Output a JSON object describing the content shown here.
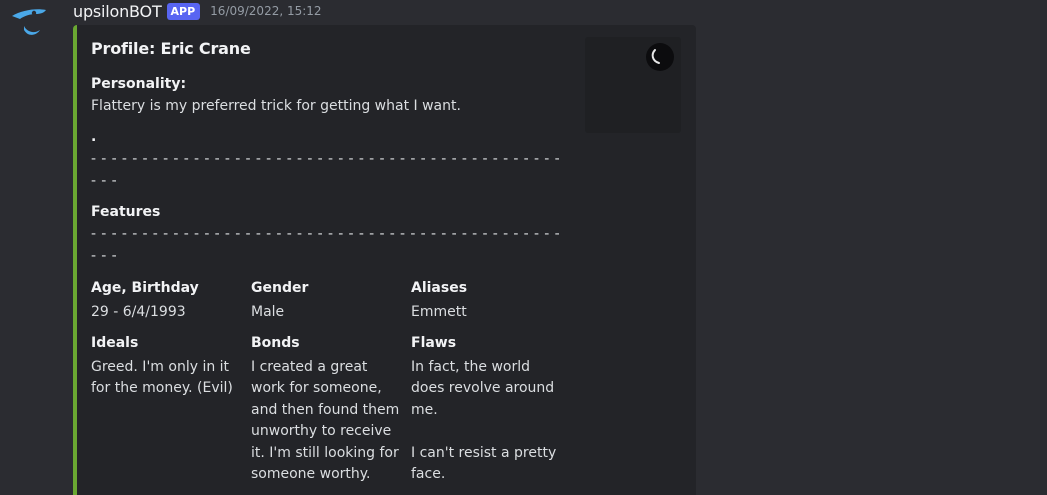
{
  "message": {
    "username": "upsilonBOT",
    "badge": "APP",
    "timestamp": "16/09/2022, 15:12"
  },
  "colors": {
    "embed_accent": "#6aa832",
    "badge_bg": "#5865f2",
    "avatar": "#4aa8e8"
  },
  "embed": {
    "title": "Profile: Eric Crane",
    "personality_label": "Personality:",
    "personality_text": "Flattery is my preferred trick for getting what I want.",
    "dot": ".",
    "separator_line1": "- - - - - - - - - - - - - - - - - - - - - - - - - - - - - - - - - - - - - - - - - - - - - -",
    "separator_line2": "- - -",
    "features_label": "Features",
    "separator2_line1": "- - - - - - - - - - - - - - - - - - - - - - - - - - - - - - - - - - - - - - - - - - - - - -",
    "separator2_line2": "- - -",
    "fields": [
      {
        "name": "Age, Birthday",
        "value": "29 - 6/4/1993"
      },
      {
        "name": "Gender",
        "value": "Male"
      },
      {
        "name": "Aliases",
        "value": "Emmett"
      },
      {
        "name": "Ideals",
        "value": "Greed. I'm only in it for the money. (Evil)"
      },
      {
        "name": "Bonds",
        "value": "I created a great work for someone, and then found them unworthy to receive it. I'm still looking for someone worthy."
      },
      {
        "name": "Flaws",
        "value": "In fact, the world does revolve around me.\n\nI can't resist a pretty face."
      }
    ]
  }
}
